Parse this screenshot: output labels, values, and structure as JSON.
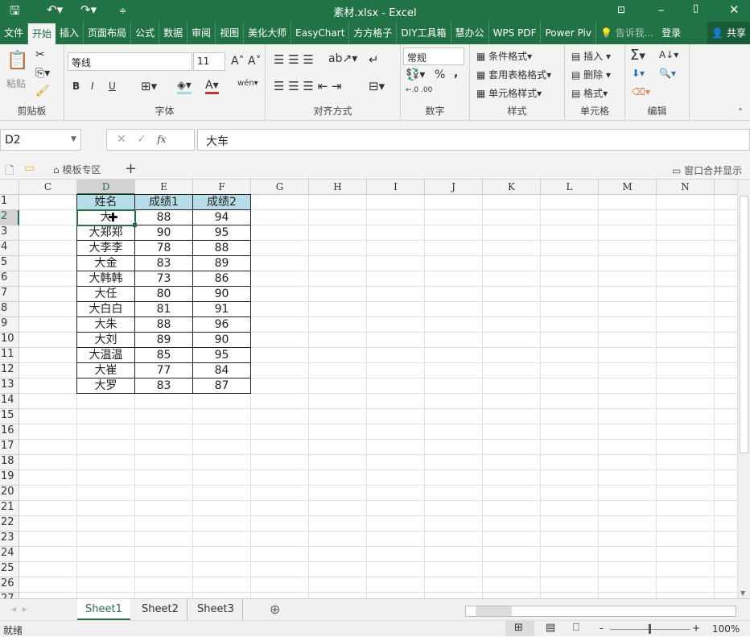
{
  "title": "素材.xlsx - Excel",
  "tabs": [
    "文件",
    "开始",
    "插入",
    "页面布局",
    "公式",
    "数据",
    "审阅",
    "视图",
    "美化大师",
    "EasyChart",
    "方方格子",
    "DIY工具箱",
    "慧办公",
    "WPS PDF",
    "Power Piv"
  ],
  "tell_me": "告诉我...",
  "login": "登录",
  "share": "共享",
  "ribbon": {
    "clipboard": {
      "label": "剪贴板",
      "paste": "粘贴"
    },
    "font": {
      "label": "字体",
      "name": "等线",
      "size": "11",
      "bold": "B",
      "italic": "I",
      "underline": "U"
    },
    "align": {
      "label": "对齐方式"
    },
    "number": {
      "label": "数字",
      "format": "常规",
      "percent": "%",
      "comma": ","
    },
    "styles": {
      "label": "样式",
      "items": [
        "条件格式",
        "套用表格格式",
        "单元格样式"
      ]
    },
    "cells": {
      "label": "单元格",
      "items": [
        "插入",
        "删除",
        "格式"
      ]
    },
    "edit": {
      "label": "编辑"
    }
  },
  "formula": {
    "name_box": "D2",
    "value": "大车",
    "fx": "fx"
  },
  "doctabs": {
    "template": "模板专区",
    "merge": "窗口合并显示"
  },
  "columns": [
    "C",
    "D",
    "E",
    "F",
    "G",
    "H",
    "I",
    "J",
    "K",
    "L",
    "M",
    "N"
  ],
  "table": {
    "headers": [
      "姓名",
      "成绩1",
      "成绩2"
    ],
    "rows": [
      [
        "大车",
        "88",
        "94"
      ],
      [
        "大郑郑",
        "90",
        "95"
      ],
      [
        "大李李",
        "78",
        "88"
      ],
      [
        "大金",
        "83",
        "89"
      ],
      [
        "大韩韩",
        "73",
        "86"
      ],
      [
        "大任",
        "80",
        "90"
      ],
      [
        "大白白",
        "81",
        "91"
      ],
      [
        "大朱",
        "88",
        "96"
      ],
      [
        "大刘",
        "89",
        "90"
      ],
      [
        "大温温",
        "85",
        "95"
      ],
      [
        "大崔",
        "77",
        "84"
      ],
      [
        "大罗",
        "83",
        "87"
      ]
    ]
  },
  "visible_cell_D2": "大",
  "sheets": [
    "Sheet1",
    "Sheet2",
    "Sheet3"
  ],
  "active_sheet": "Sheet1",
  "status": {
    "ready": "就绪",
    "zoom": "100%"
  },
  "colors": {
    "brand": "#217346",
    "header_fill": "#b7dde8"
  }
}
